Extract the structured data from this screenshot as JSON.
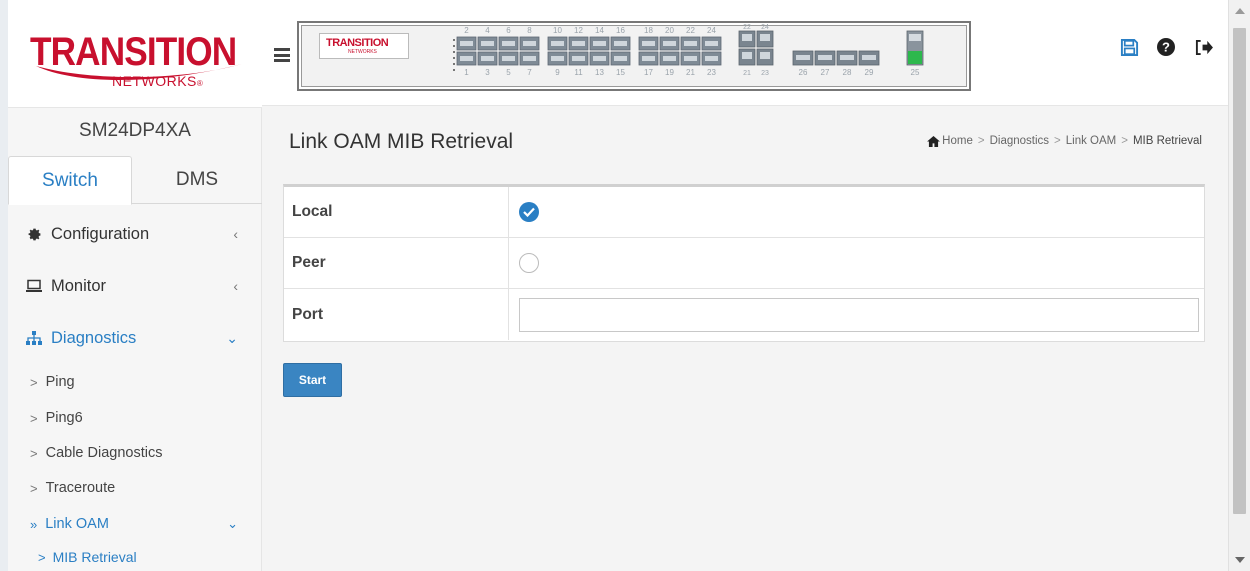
{
  "logo": {
    "brand": "TRANSITION",
    "sub": "NETWORKS"
  },
  "device": {
    "name": "SM24DP4XA"
  },
  "tabs": {
    "switch": "Switch",
    "dms": "DMS"
  },
  "nav": {
    "configuration": "Configuration",
    "monitor": "Monitor",
    "diagnostics": "Diagnostics",
    "sub": {
      "ping": "Ping",
      "ping6": "Ping6",
      "cable": "Cable Diagnostics",
      "traceroute": "Traceroute",
      "link_oam": "Link OAM",
      "mib_retrieval": "MIB Retrieval"
    }
  },
  "panel": {
    "logo_text": "TRANSITION",
    "logo_sub": "NETWORKS",
    "top_ports": [
      "2",
      "4",
      "6",
      "8",
      "10",
      "12",
      "14",
      "16",
      "18",
      "20",
      "22",
      "24",
      "22",
      "24"
    ],
    "bottom_ports": [
      "1",
      "3",
      "5",
      "7",
      "9",
      "11",
      "13",
      "15",
      "17",
      "19",
      "21",
      "23",
      "21",
      "23",
      "26",
      "27",
      "28",
      "29",
      "25"
    ]
  },
  "breadcrumb": {
    "home": "Home",
    "diagnostics": "Diagnostics",
    "link_oam": "Link OAM",
    "current": "MIB Retrieval"
  },
  "page": {
    "title": "Link OAM MIB Retrieval"
  },
  "form": {
    "local_label": "Local",
    "peer_label": "Peer",
    "port_label": "Port",
    "local_selected": true,
    "port_value": ""
  },
  "buttons": {
    "start": "Start"
  },
  "colors": {
    "accent": "#2a7fc4",
    "brand_red": "#c8102e",
    "button": "#3a85c2",
    "port_active": "#2db84d"
  },
  "icons": {
    "save": "save-icon",
    "help": "help-icon",
    "logout": "logout-icon",
    "configuration": "gear-icon",
    "monitor": "laptop-icon",
    "diagnostics": "sitemap-icon",
    "home": "home-icon",
    "menu": "hamburger-icon"
  }
}
